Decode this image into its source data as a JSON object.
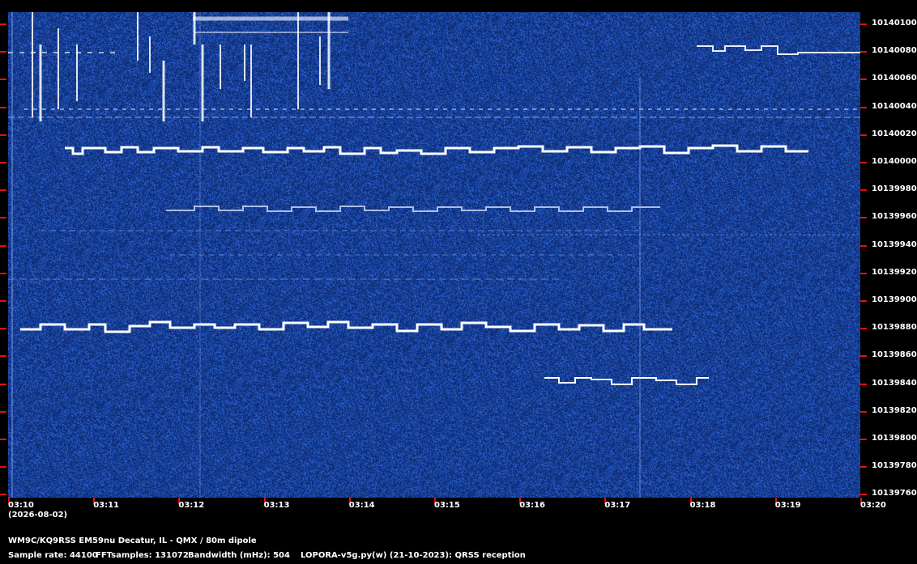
{
  "frequency_labels": [
    "10140100",
    "10140080",
    "10140060",
    "10140040",
    "10140020",
    "10140000",
    "10139980",
    "10139960",
    "10139940",
    "10139920",
    "10139900",
    "10139880",
    "10139860",
    "10139840",
    "10139820",
    "10139800",
    "10139780",
    "10139760"
  ],
  "time_labels": [
    "03:10",
    "03:11",
    "03:12",
    "03:13",
    "03:14",
    "03:15",
    "03:16",
    "03:17",
    "03:18",
    "03:19",
    "03:20"
  ],
  "date_label": "(2026-08-02)",
  "station_line": "WM9C/KQ9RSS EM59nu Decatur, IL - QMX / 80m dipole",
  "sample_rate_label": "Sample rate: 44100",
  "fft_samples_label": "FFTsamples: 131072",
  "bandwidth_label": "Bandwidth (mHz): 504",
  "software_label": "LOPORA-v5g.py(w) (21-10-2023): QRSS reception",
  "colors": {
    "background": "#000000",
    "waterfall": "#123580",
    "tick": "#e01010",
    "signal": "#ffffff"
  }
}
